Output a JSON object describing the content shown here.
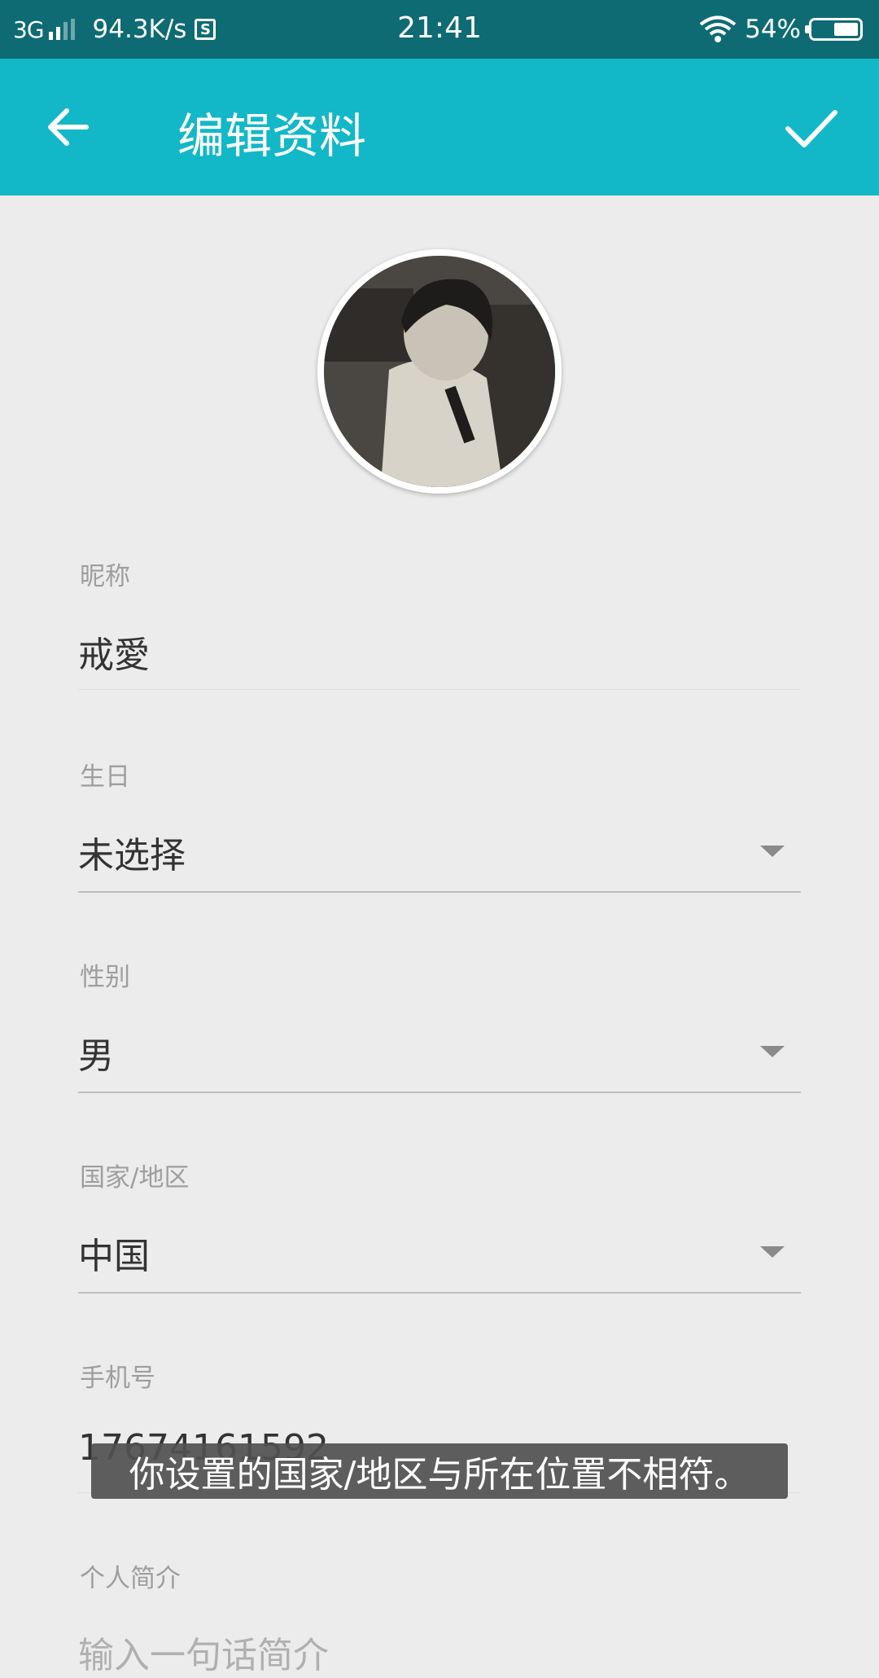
{
  "status_bar": {
    "network": "3G",
    "speed": "94.3K/s",
    "s_icon_letter": "S",
    "time": "21:41",
    "battery": "54%"
  },
  "toolbar": {
    "title": "编辑资料",
    "back_icon": "arrow-back-icon",
    "confirm_icon": "check-icon"
  },
  "profile": {
    "avatar": "avatar-photo"
  },
  "fields": {
    "nickname": {
      "label": "昵称",
      "value": "戒愛"
    },
    "birthday": {
      "label": "生日",
      "value": "未选择"
    },
    "gender": {
      "label": "性别",
      "value": "男"
    },
    "region": {
      "label": "国家/地区",
      "value": "中国"
    },
    "phone": {
      "label": "手机号",
      "value": "17674161592"
    },
    "bio": {
      "label": "个人简介",
      "placeholder": "输入一句话简介"
    }
  },
  "toast": {
    "text": "你设置的国家/地区与所在位置不相符。"
  },
  "colors": {
    "status_bar": "#0e6b74",
    "toolbar": "#13b8c8",
    "background": "#ececec"
  }
}
